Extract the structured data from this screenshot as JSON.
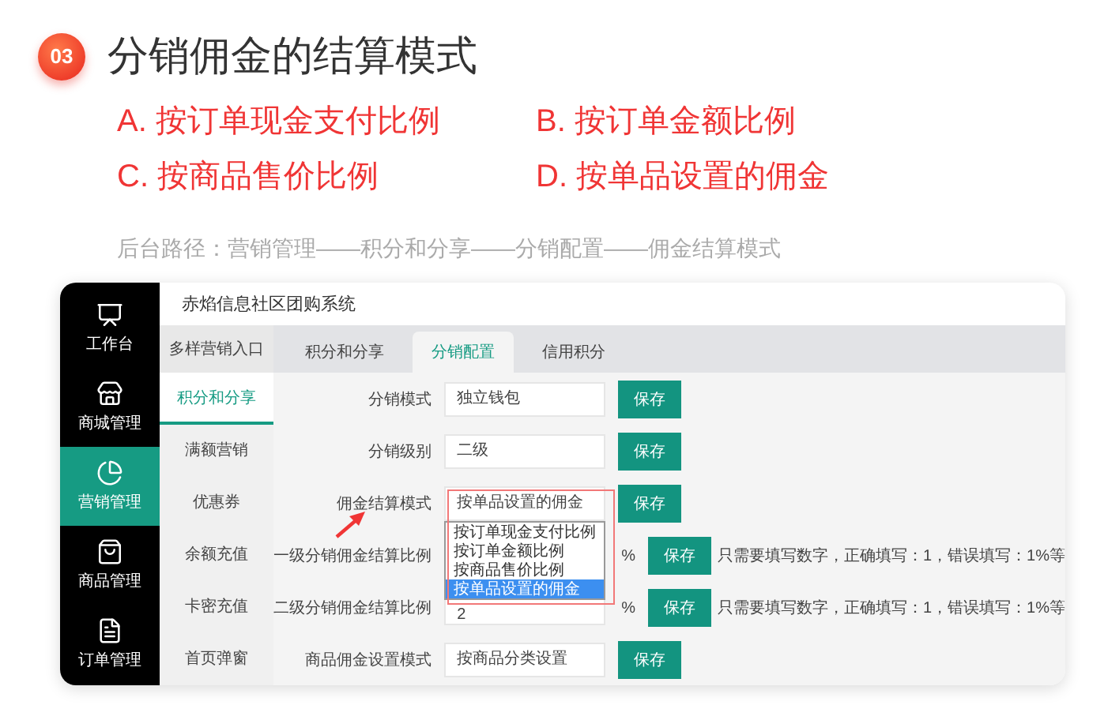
{
  "badge": "03",
  "title": "分销佣金的结算模式",
  "options": [
    "A. 按订单现金支付比例",
    "B. 按订单金额比例",
    "C. 按商品售价比例",
    "D. 按单品设置的佣金"
  ],
  "path": "后台路径：营销管理——积分和分享——分销配置——佣金结算模式",
  "app": {
    "title": "赤焰信息社区团购系统",
    "nav": [
      {
        "label": "工作台",
        "selected": false
      },
      {
        "label": "商城管理",
        "selected": false
      },
      {
        "label": "营销管理",
        "selected": true
      },
      {
        "label": "商品管理",
        "selected": false
      },
      {
        "label": "订单管理",
        "selected": false
      }
    ],
    "subnav": {
      "title": "多样营销入口",
      "items": [
        {
          "label": "积分和分享",
          "selected": true
        },
        {
          "label": "满额营销",
          "selected": false
        },
        {
          "label": "优惠券",
          "selected": false
        },
        {
          "label": "余额充值",
          "selected": false
        },
        {
          "label": "卡密充值",
          "selected": false
        },
        {
          "label": "首页弹窗",
          "selected": false
        }
      ]
    },
    "tabs": [
      {
        "label": "积分和分享",
        "selected": false
      },
      {
        "label": "分销配置",
        "selected": true
      },
      {
        "label": "信用积分",
        "selected": false
      }
    ],
    "form": [
      {
        "kind": "select",
        "label": "分销模式",
        "value": "独立钱包",
        "button": "保存"
      },
      {
        "kind": "select",
        "label": "分销级别",
        "value": "二级",
        "button": "保存"
      },
      {
        "kind": "select",
        "label": "佣金结算模式",
        "value": "按单品设置的佣金",
        "button": "保存",
        "dropdown": [
          {
            "label": "按订单现金支付比例",
            "selected": false
          },
          {
            "label": "按订单金额比例",
            "selected": false
          },
          {
            "label": "按商品售价比例",
            "selected": false
          },
          {
            "label": "按单品设置的佣金",
            "selected": true
          }
        ]
      },
      {
        "kind": "percent",
        "label": "一级分销佣金结算比例",
        "unit": "%",
        "button": "保存",
        "hint": "只需要填写数字，正确填写：1，错误填写：1%等"
      },
      {
        "kind": "percent",
        "label": "二级分销佣金结算比例",
        "value": "2",
        "unit": "%",
        "button": "保存",
        "hint": "只需要填写数字，正确填写：1，错误填写：1%等"
      },
      {
        "kind": "select",
        "label": "商品佣金设置模式",
        "value": "按商品分类设置",
        "button": "保存"
      }
    ]
  }
}
